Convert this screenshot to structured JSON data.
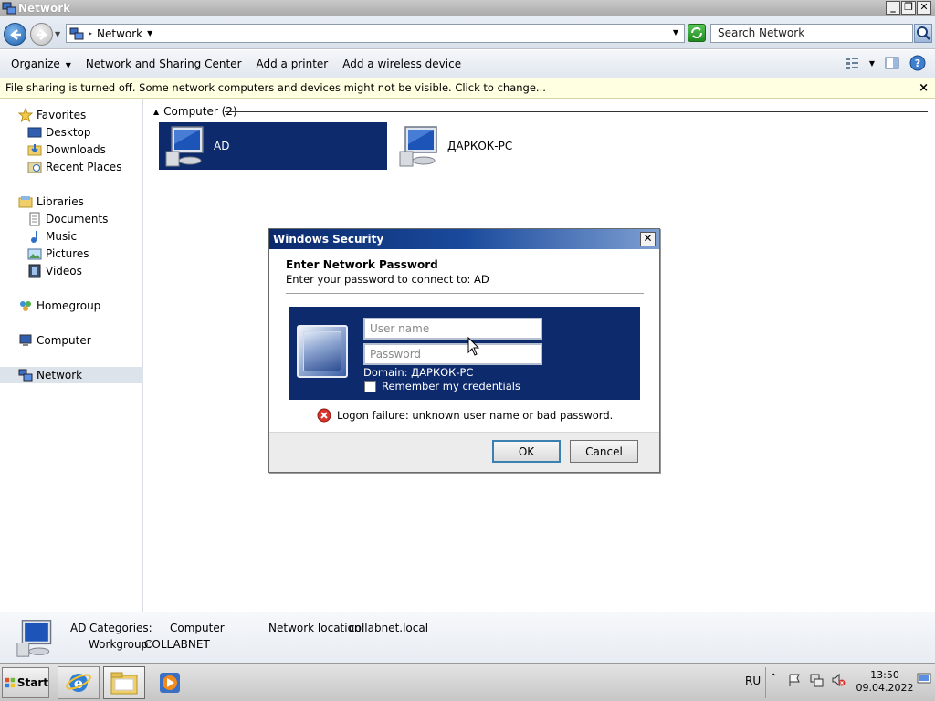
{
  "window": {
    "title": "Network"
  },
  "address": {
    "crumb": "Network",
    "search_placeholder": "Search Network"
  },
  "toolbar": {
    "organize": "Organize",
    "network_sharing_center": "Network and Sharing Center",
    "add_printer": "Add a printer",
    "add_wireless": "Add a wireless device"
  },
  "infobar": {
    "text": "File sharing is turned off. Some network computers and devices might not be visible. Click to change...",
    "close": "×"
  },
  "nav": {
    "favorites": "Favorites",
    "desktop": "Desktop",
    "downloads": "Downloads",
    "recent_places": "Recent Places",
    "libraries": "Libraries",
    "documents": "Documents",
    "music": "Music",
    "pictures": "Pictures",
    "videos": "Videos",
    "homegroup": "Homegroup",
    "computer": "Computer",
    "network": "Network"
  },
  "content": {
    "group_header": "Computer (2)",
    "items": [
      {
        "label": "AD",
        "selected": true
      },
      {
        "label": "ДАРКОК-PC",
        "selected": false
      }
    ]
  },
  "details": {
    "name": "AD",
    "categories_label": "Categories:",
    "categories_value": "Computer",
    "workgroup_label": "Workgroup:",
    "workgroup_value": "COLLABNET",
    "location_label": "Network location:",
    "location_value": "collabnet.local"
  },
  "dialog": {
    "title": "Windows Security",
    "heading": "Enter Network Password",
    "subtitle": "Enter your password to connect to: AD",
    "username_placeholder": "User name",
    "password_placeholder": "Password",
    "domain": "Domain: ДАРКОК-PC",
    "remember": "Remember my credentials",
    "error": "Logon failure: unknown user name or bad password.",
    "ok": "OK",
    "cancel": "Cancel"
  },
  "taskbar": {
    "start": "Start",
    "language": "RU",
    "time": "13:50",
    "date": "09.04.2022"
  },
  "colors": {
    "selection": "#0d2a6c",
    "infobar": "#ffffe1",
    "dialog_title": "#0b2a6b"
  }
}
